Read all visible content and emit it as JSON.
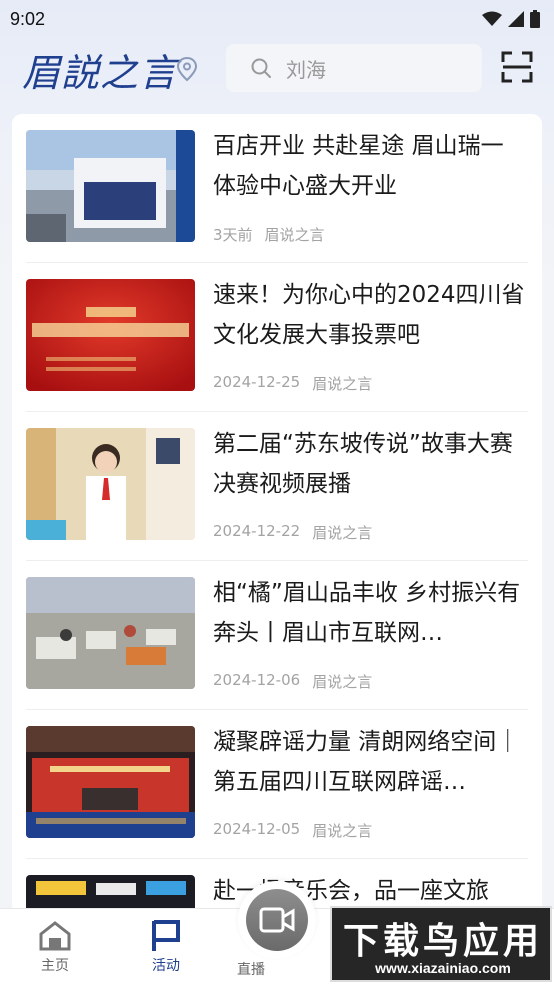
{
  "status": {
    "time": "9:02"
  },
  "header": {
    "logo_text": "眉説之言",
    "search_placeholder": "刘海"
  },
  "articles": [
    {
      "title": "百店开业 共赴星途 眉山瑞一体验中心盛大开业",
      "date": "3天前",
      "source": "眉说之言"
    },
    {
      "title": "速来！为你心中的2024四川省文化发展大事投票吧",
      "date": "2024-12-25",
      "source": "眉说之言"
    },
    {
      "title": "第二届“苏东坡传说”故事大赛决赛视频展播",
      "date": "2024-12-22",
      "source": "眉说之言"
    },
    {
      "title": "相“橘”眉山品丰收 乡村振兴有奔头丨眉山市互联网…",
      "date": "2024-12-06",
      "source": "眉说之言"
    },
    {
      "title": "凝聚辟谣力量 清朗网络空间｜第五届四川互联网辟谣…",
      "date": "2024-12-05",
      "source": "眉说之言"
    },
    {
      "title": "赴一场音乐会，品一座文旅",
      "date": "",
      "source": ""
    }
  ],
  "tabbar": {
    "home": "主页",
    "activity": "活动",
    "live": "直播"
  },
  "watermark": {
    "title": "下载鸟应用",
    "url": "www.xiazainiao.com"
  },
  "colors": {
    "accent": "#1f3f8f"
  }
}
